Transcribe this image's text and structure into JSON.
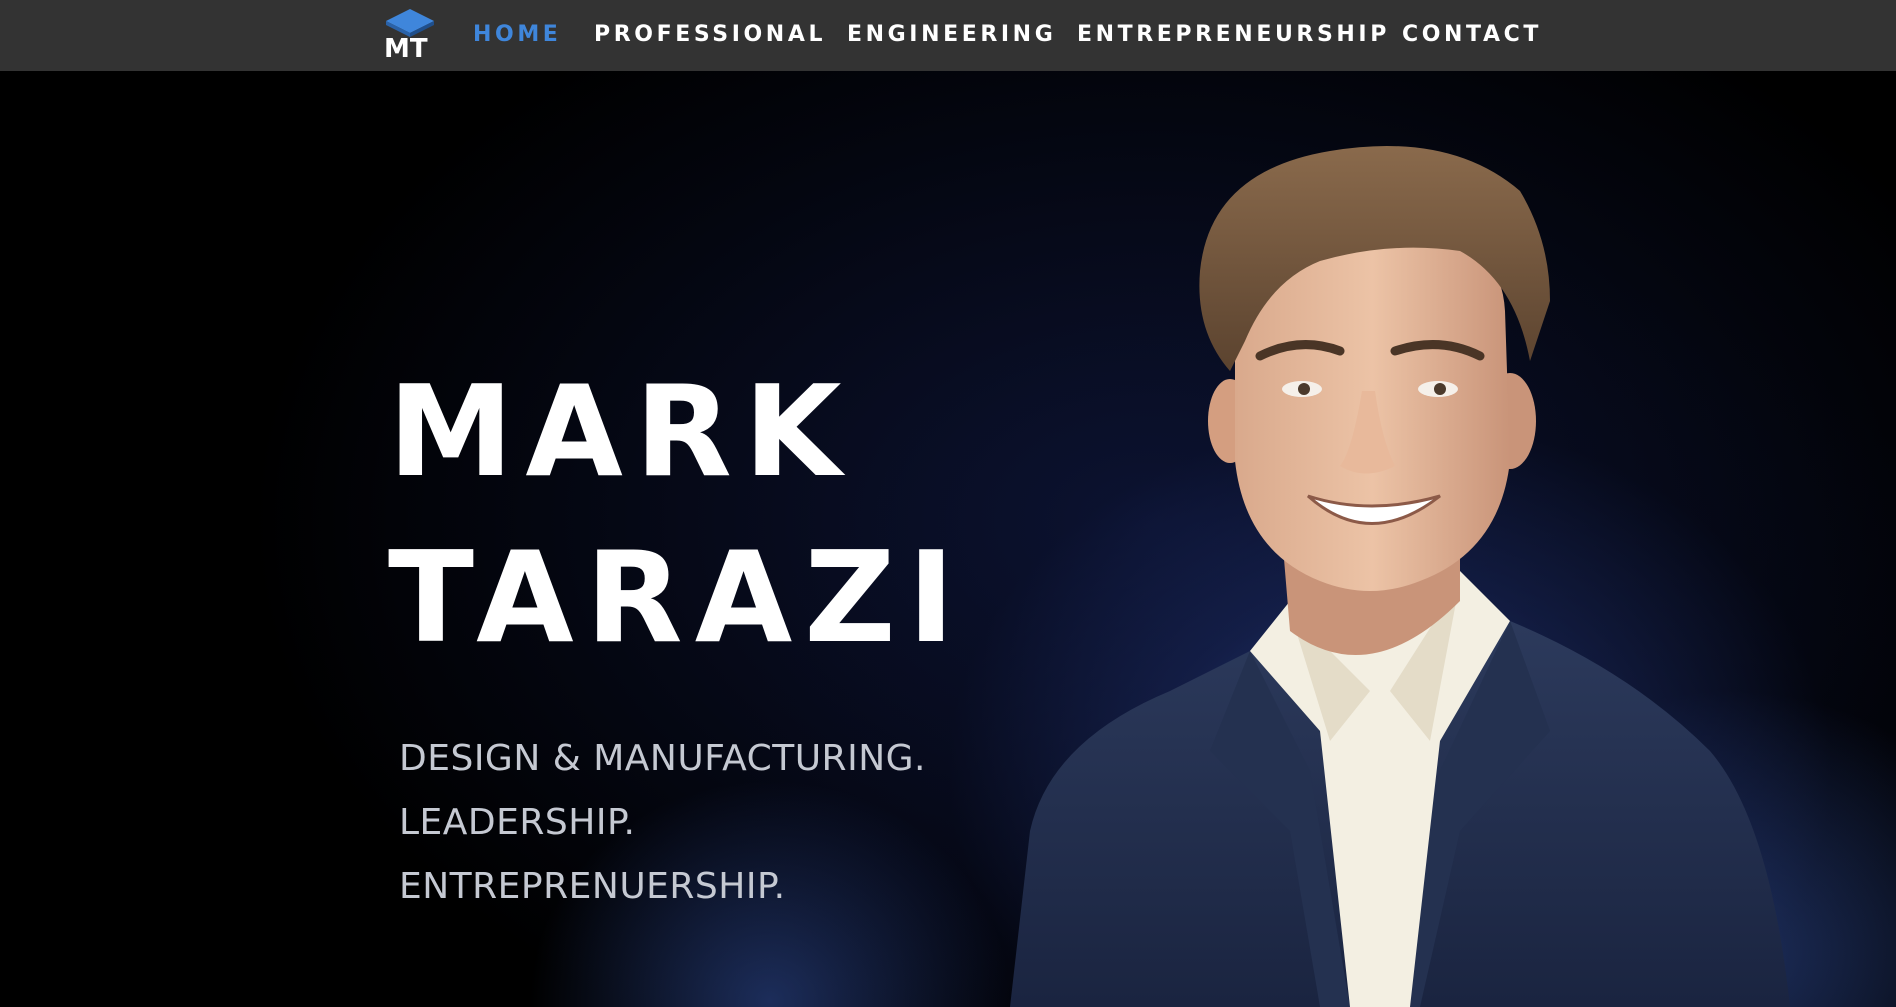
{
  "nav": {
    "logo_text": "MT",
    "items": [
      {
        "label": "HOME",
        "active": true
      },
      {
        "label": "PROFESSIONAL",
        "active": false
      },
      {
        "label": "ENGINEERING",
        "active": false
      },
      {
        "label": "ENTREPRENEURSHIP",
        "active": false
      },
      {
        "label": "CONTACT",
        "active": false
      }
    ]
  },
  "hero": {
    "name_first": "MARK",
    "name_last": "TARAZI",
    "taglines": [
      "DESIGN & MANUFACTURING.",
      "LEADERSHIP.",
      "ENTREPRENUERSHIP."
    ]
  },
  "colors": {
    "nav_background": "#333333",
    "accent": "#3f86db",
    "hero_background": "#000000",
    "glow": "#3a56aa",
    "name_text": "#ffffff",
    "tagline_text": "#c5c9d2"
  },
  "icons": {
    "logo": "mt-cube-logo",
    "portrait": "person-portrait"
  }
}
